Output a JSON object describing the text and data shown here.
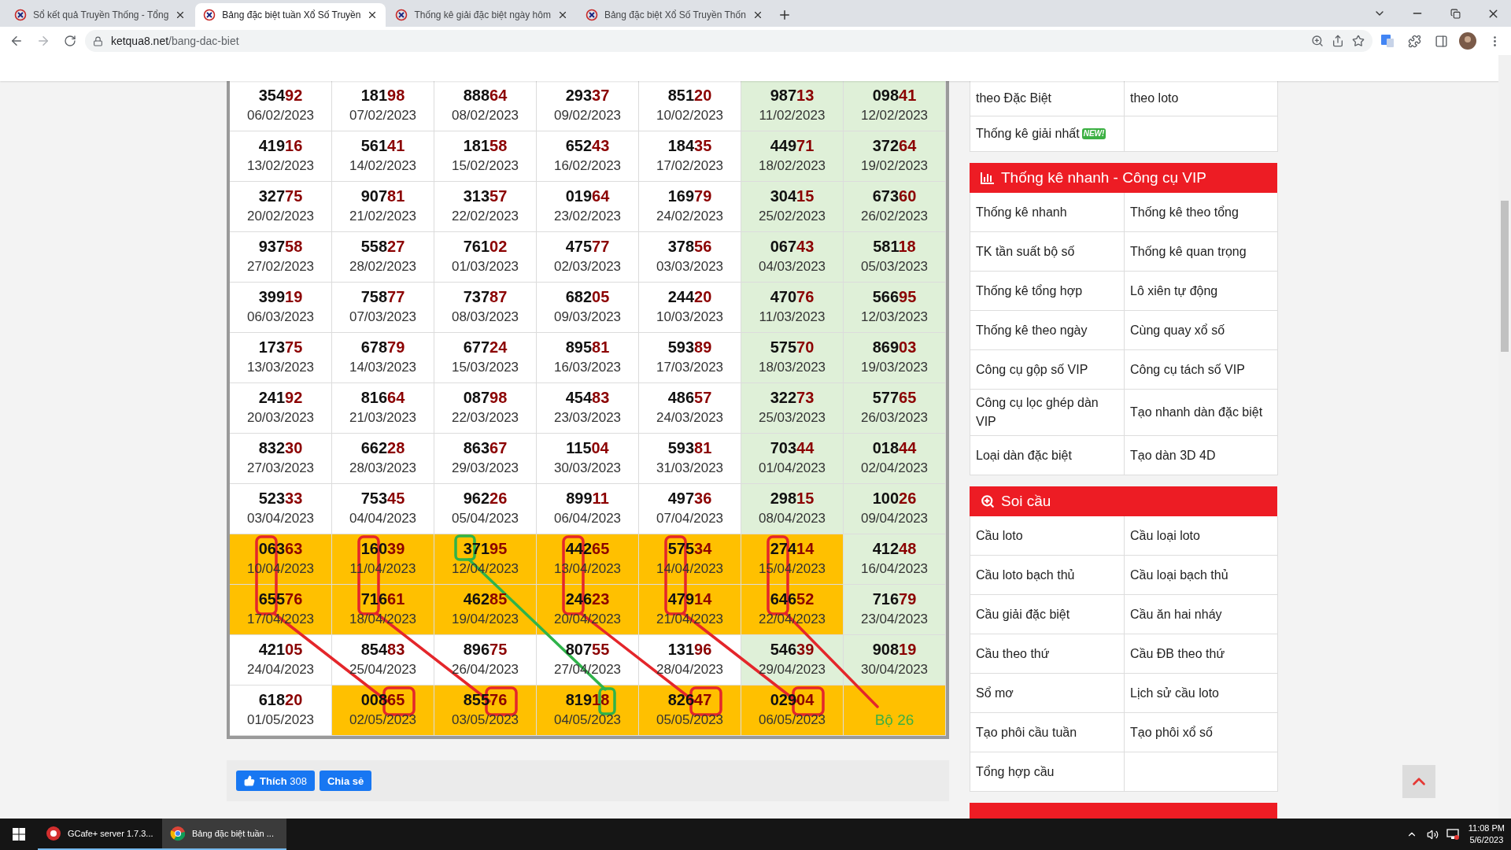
{
  "browser": {
    "tabs": [
      {
        "title": "Sổ kết quả Truyền Thống - Tổng",
        "selected": false
      },
      {
        "title": "Bảng đặc biệt tuần Xổ Số Truyền",
        "selected": true
      },
      {
        "title": "Thống kê giải đặc biệt ngày hôm",
        "selected": false
      },
      {
        "title": "Bảng đặc biệt Xổ Số Truyền Thốn",
        "selected": false
      }
    ],
    "url_host": "ketqua8.net",
    "url_path": "/bang-dac-biet"
  },
  "results_table": {
    "rows": [
      [
        {
          "number": "35492",
          "date": "06/02/2023",
          "weekend": false,
          "marked": false
        },
        {
          "number": "18198",
          "date": "07/02/2023",
          "weekend": false,
          "marked": false
        },
        {
          "number": "88864",
          "date": "08/02/2023",
          "weekend": false,
          "marked": false
        },
        {
          "number": "29337",
          "date": "09/02/2023",
          "weekend": false,
          "marked": false
        },
        {
          "number": "85120",
          "date": "10/02/2023",
          "weekend": false,
          "marked": false
        },
        {
          "number": "98713",
          "date": "11/02/2023",
          "weekend": true,
          "marked": false
        },
        {
          "number": "09841",
          "date": "12/02/2023",
          "weekend": true,
          "marked": false
        }
      ],
      [
        {
          "number": "41916",
          "date": "13/02/2023",
          "weekend": false,
          "marked": false
        },
        {
          "number": "56141",
          "date": "14/02/2023",
          "weekend": false,
          "marked": false
        },
        {
          "number": "18158",
          "date": "15/02/2023",
          "weekend": false,
          "marked": false
        },
        {
          "number": "65243",
          "date": "16/02/2023",
          "weekend": false,
          "marked": false
        },
        {
          "number": "18435",
          "date": "17/02/2023",
          "weekend": false,
          "marked": false
        },
        {
          "number": "44971",
          "date": "18/02/2023",
          "weekend": true,
          "marked": false
        },
        {
          "number": "37264",
          "date": "19/02/2023",
          "weekend": true,
          "marked": false
        }
      ],
      [
        {
          "number": "32775",
          "date": "20/02/2023",
          "weekend": false,
          "marked": false
        },
        {
          "number": "90781",
          "date": "21/02/2023",
          "weekend": false,
          "marked": false
        },
        {
          "number": "31357",
          "date": "22/02/2023",
          "weekend": false,
          "marked": false
        },
        {
          "number": "01964",
          "date": "23/02/2023",
          "weekend": false,
          "marked": false
        },
        {
          "number": "16979",
          "date": "24/02/2023",
          "weekend": false,
          "marked": false
        },
        {
          "number": "30415",
          "date": "25/02/2023",
          "weekend": true,
          "marked": false
        },
        {
          "number": "67360",
          "date": "26/02/2023",
          "weekend": true,
          "marked": false
        }
      ],
      [
        {
          "number": "93758",
          "date": "27/02/2023",
          "weekend": false,
          "marked": false
        },
        {
          "number": "55827",
          "date": "28/02/2023",
          "weekend": false,
          "marked": false
        },
        {
          "number": "76102",
          "date": "01/03/2023",
          "weekend": false,
          "marked": false
        },
        {
          "number": "47577",
          "date": "02/03/2023",
          "weekend": false,
          "marked": false
        },
        {
          "number": "37856",
          "date": "03/03/2023",
          "weekend": false,
          "marked": false
        },
        {
          "number": "06743",
          "date": "04/03/2023",
          "weekend": true,
          "marked": false
        },
        {
          "number": "58118",
          "date": "05/03/2023",
          "weekend": true,
          "marked": false
        }
      ],
      [
        {
          "number": "39919",
          "date": "06/03/2023",
          "weekend": false,
          "marked": false
        },
        {
          "number": "75877",
          "date": "07/03/2023",
          "weekend": false,
          "marked": false
        },
        {
          "number": "73787",
          "date": "08/03/2023",
          "weekend": false,
          "marked": false
        },
        {
          "number": "68205",
          "date": "09/03/2023",
          "weekend": false,
          "marked": false
        },
        {
          "number": "24420",
          "date": "10/03/2023",
          "weekend": false,
          "marked": false
        },
        {
          "number": "47076",
          "date": "11/03/2023",
          "weekend": true,
          "marked": false
        },
        {
          "number": "56695",
          "date": "12/03/2023",
          "weekend": true,
          "marked": false
        }
      ],
      [
        {
          "number": "17375",
          "date": "13/03/2023",
          "weekend": false,
          "marked": false
        },
        {
          "number": "67879",
          "date": "14/03/2023",
          "weekend": false,
          "marked": false
        },
        {
          "number": "67724",
          "date": "15/03/2023",
          "weekend": false,
          "marked": false
        },
        {
          "number": "89581",
          "date": "16/03/2023",
          "weekend": false,
          "marked": false
        },
        {
          "number": "59389",
          "date": "17/03/2023",
          "weekend": false,
          "marked": false
        },
        {
          "number": "57570",
          "date": "18/03/2023",
          "weekend": true,
          "marked": false
        },
        {
          "number": "86903",
          "date": "19/03/2023",
          "weekend": true,
          "marked": false
        }
      ],
      [
        {
          "number": "24192",
          "date": "20/03/2023",
          "weekend": false,
          "marked": false
        },
        {
          "number": "81664",
          "date": "21/03/2023",
          "weekend": false,
          "marked": false
        },
        {
          "number": "08798",
          "date": "22/03/2023",
          "weekend": false,
          "marked": false
        },
        {
          "number": "45483",
          "date": "23/03/2023",
          "weekend": false,
          "marked": false
        },
        {
          "number": "48657",
          "date": "24/03/2023",
          "weekend": false,
          "marked": false
        },
        {
          "number": "32273",
          "date": "25/03/2023",
          "weekend": true,
          "marked": false
        },
        {
          "number": "57765",
          "date": "26/03/2023",
          "weekend": true,
          "marked": false
        }
      ],
      [
        {
          "number": "83230",
          "date": "27/03/2023",
          "weekend": false,
          "marked": false
        },
        {
          "number": "66228",
          "date": "28/03/2023",
          "weekend": false,
          "marked": false
        },
        {
          "number": "86367",
          "date": "29/03/2023",
          "weekend": false,
          "marked": false
        },
        {
          "number": "11504",
          "date": "30/03/2023",
          "weekend": false,
          "marked": false
        },
        {
          "number": "59381",
          "date": "31/03/2023",
          "weekend": false,
          "marked": false
        },
        {
          "number": "70344",
          "date": "01/04/2023",
          "weekend": true,
          "marked": false
        },
        {
          "number": "01844",
          "date": "02/04/2023",
          "weekend": true,
          "marked": false
        }
      ],
      [
        {
          "number": "52333",
          "date": "03/04/2023",
          "weekend": false,
          "marked": false
        },
        {
          "number": "75345",
          "date": "04/04/2023",
          "weekend": false,
          "marked": false
        },
        {
          "number": "96226",
          "date": "05/04/2023",
          "weekend": false,
          "marked": false
        },
        {
          "number": "89911",
          "date": "06/04/2023",
          "weekend": false,
          "marked": false
        },
        {
          "number": "49736",
          "date": "07/04/2023",
          "weekend": false,
          "marked": false
        },
        {
          "number": "29815",
          "date": "08/04/2023",
          "weekend": true,
          "marked": false
        },
        {
          "number": "10026",
          "date": "09/04/2023",
          "weekend": true,
          "marked": false
        }
      ],
      [
        {
          "number": "06363",
          "date": "10/04/2023",
          "marked": true
        },
        {
          "number": "16039",
          "date": "11/04/2023",
          "marked": true
        },
        {
          "number": "37195",
          "date": "12/04/2023",
          "marked": true
        },
        {
          "number": "44265",
          "date": "13/04/2023",
          "marked": true
        },
        {
          "number": "57534",
          "date": "14/04/2023",
          "marked": true
        },
        {
          "number": "27414",
          "date": "15/04/2023",
          "marked": true
        },
        {
          "number": "41248",
          "date": "16/04/2023",
          "weekend": true,
          "marked": false
        }
      ],
      [
        {
          "number": "65576",
          "date": "17/04/2023",
          "marked": true
        },
        {
          "number": "71661",
          "date": "18/04/2023",
          "marked": true
        },
        {
          "number": "46285",
          "date": "19/04/2023",
          "marked": true
        },
        {
          "number": "24623",
          "date": "20/04/2023",
          "marked": true
        },
        {
          "number": "47914",
          "date": "21/04/2023",
          "marked": true
        },
        {
          "number": "64652",
          "date": "22/04/2023",
          "marked": true
        },
        {
          "number": "71679",
          "date": "23/04/2023",
          "weekend": true,
          "marked": false
        }
      ],
      [
        {
          "number": "42105",
          "date": "24/04/2023",
          "weekend": false,
          "marked": false
        },
        {
          "number": "85483",
          "date": "25/04/2023",
          "weekend": false,
          "marked": false
        },
        {
          "number": "89675",
          "date": "26/04/2023",
          "weekend": false,
          "marked": false
        },
        {
          "number": "80755",
          "date": "27/04/2023",
          "weekend": false,
          "marked": false
        },
        {
          "number": "13196",
          "date": "28/04/2023",
          "weekend": false,
          "marked": false
        },
        {
          "number": "54639",
          "date": "29/04/2023",
          "weekend": true,
          "marked": false
        },
        {
          "number": "90819",
          "date": "30/04/2023",
          "weekend": true,
          "marked": false
        }
      ],
      [
        {
          "number": "61820",
          "date": "01/05/2023",
          "weekend": false,
          "marked": false
        },
        {
          "number": "00865",
          "date": "02/05/2023",
          "marked": true
        },
        {
          "number": "85576",
          "date": "03/05/2023",
          "marked": true
        },
        {
          "number": "81918",
          "date": "04/05/2023",
          "marked": true
        },
        {
          "number": "82647",
          "date": "05/05/2023",
          "marked": true
        },
        {
          "number": "02904",
          "date": "06/05/2023",
          "marked": true
        },
        {
          "note": "Bộ 26",
          "marked": true
        }
      ]
    ]
  },
  "social": {
    "like": "**Thích** 308",
    "share": "Chia sẻ"
  },
  "sidebar": {
    "sections": [
      {
        "rows": [
          [
            "theo Đặc Biệt",
            "theo loto"
          ],
          [
            {
              "text": "Thống kê giải nhất",
              "badge": "NEW!"
            },
            null
          ]
        ]
      },
      {
        "title": "Thống kê nhanh - Công cụ VIP",
        "rows": [
          [
            "Thống kê nhanh",
            "Thống kê theo tổng"
          ],
          [
            "TK tần suất bộ số",
            "Thống kê quan trọng"
          ],
          [
            "Thống kê tổng hợp",
            "Lô xiên tự động"
          ],
          [
            "Thống kê theo ngày",
            "Cùng quay xổ số"
          ],
          [
            "Công cụ gộp số VIP",
            "Công cụ tách số VIP"
          ],
          [
            "Công cụ lọc ghép dàn VIP",
            "Tạo nhanh dàn đặc biệt"
          ],
          [
            "Loại dàn đặc biệt",
            "Tạo dàn 3D 4D"
          ]
        ]
      },
      {
        "title": "Soi cầu",
        "rows": [
          [
            "Cầu loto",
            "Cầu loại loto"
          ],
          [
            "Cầu loto bạch thủ",
            "Cầu loại bạch thủ"
          ],
          [
            "Cầu giải đặc biệt",
            "Cầu ăn hai nháy"
          ],
          [
            "Cầu theo thứ",
            "Cầu ĐB theo thứ"
          ],
          [
            "Sổ mơ",
            "Lịch sử cầu loto"
          ],
          [
            "Tạo phôi cầu tuần",
            "Tạo phôi xổ số"
          ],
          [
            "Tổng hợp cầu",
            null
          ]
        ]
      }
    ]
  },
  "taskbar": {
    "items": [
      {
        "label": "GCafe+ server 1.7.3...",
        "selected": false
      },
      {
        "label": "Bảng đặc biệt tuần ...",
        "selected": true
      }
    ],
    "time": "11:08 PM",
    "date": "5/6/2023"
  }
}
